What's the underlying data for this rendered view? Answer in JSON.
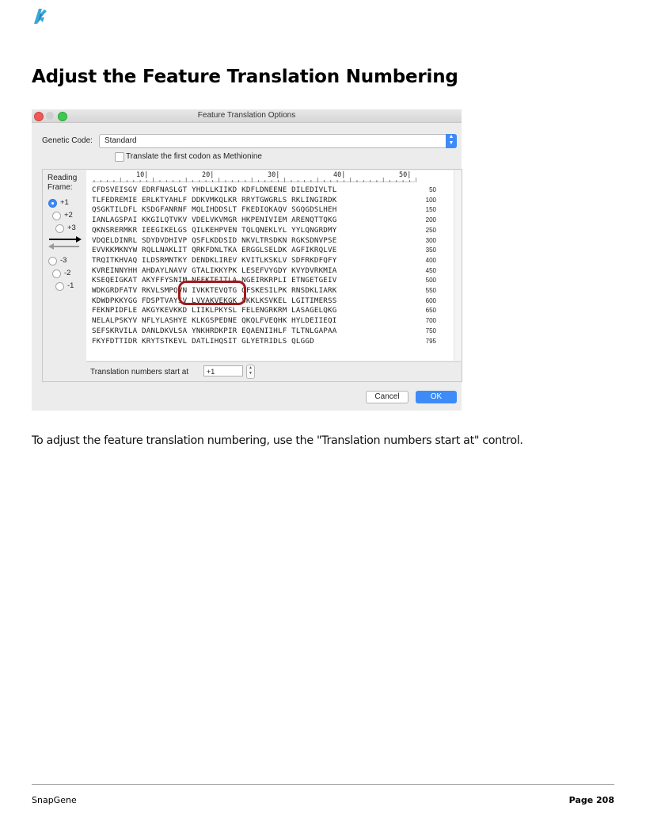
{
  "page": {
    "title": "Adjust the Feature Translation Numbering",
    "body": "To adjust the feature translation numbering, use the \"Translation numbers start at\" control.",
    "footer_left": "SnapGene",
    "footer_right": "Page 208"
  },
  "dialog": {
    "title": "Feature Translation Options",
    "genetic_code_label": "Genetic Code:",
    "genetic_code_value": "Standard",
    "methionine_label": "Translate the first codon as Methionine",
    "methionine_checked": false,
    "reading_frame_label_1": "Reading",
    "reading_frame_label_2": "Frame:",
    "frames": [
      "+1",
      "+2",
      "+3",
      "-3",
      "-2",
      "-1"
    ],
    "selected_frame": "+1",
    "ruler": [
      "10|",
      "20|",
      "30|",
      "40|",
      "50|"
    ],
    "sequence_rows": [
      {
        "seq": "CFDSVEISGV EDRFNASLGT YHDLLKIIKD KDFLDNEENE DILEDIVLTL",
        "num": "50"
      },
      {
        "seq": "TLFEDREMIE ERLKTYAHLF DDKVMKQLKR RRYTGWGRLS RKLINGIRDK",
        "num": "100"
      },
      {
        "seq": "QSGKTILDFL KSDGFANRNF MQLIHDDSLT FKEDIQKAQV SGQGDSLHEH",
        "num": "150"
      },
      {
        "seq": "IANLAGSPAI KKGILQTVKV VDELVKVMGR HKPENIVIEM ARENQTTQKG",
        "num": "200"
      },
      {
        "seq": "QKNSRERMKR IEEGIKELGS QILKEHPVEN TQLQNEKLYL YYLQNGRDMY",
        "num": "250"
      },
      {
        "seq": "VDQELDINRL SDYDVDHIVP QSFLKDDSID NKVLTRSDKN RGKSDNVPSE",
        "num": "300"
      },
      {
        "seq": "EVVKKMKNYW RQLLNAKLIT QRKFDNLTKA ERGGLSELDK AGFIKRQLVE",
        "num": "350"
      },
      {
        "seq": "TRQITKHVAQ ILDSRMNTKY DENDKLIREV KVITLKSKLV SDFRKDFQFY",
        "num": "400"
      },
      {
        "seq": "KVREINNYHH AHDAYLNAVV GTALIKKYPK LESEFVYGDY KVYDVRKMIA",
        "num": "450"
      },
      {
        "seq": "KSEQEIGKAT AKYFFYSNIM NFFKTEITLA NGEIRKRPLI ETNGETGEIV",
        "num": "500"
      },
      {
        "seq": "WDKGRDFATV RKVLSMPQVN IVKKTEVQTG GFSKESILPK RNSDKLIARK",
        "num": "550"
      },
      {
        "seq": "KDWDPKKYGG FDSPTVAYSV LVVAKVEKGK SKKLKSVKEL LGITIMERSS",
        "num": "600"
      },
      {
        "seq": "FEKNPIDFLE AKGYKEVKKD LIIKLPKYSL FELENGRKRM LASAGELQKG",
        "num": "650"
      },
      {
        "seq": "NELALPSKYV NFLYLASHYE KLKGSPEDNE QKQLFVEQHK HYLDEIIEQI",
        "num": "700"
      },
      {
        "seq": "SEFSKRVILA DANLDKVLSA YNKHRDKPIR EQAENIIHLF TLTNLGAPAA",
        "num": "750"
      },
      {
        "seq": "FKYFDTTIDR KRYTSTKEVL DATLIHQSIT GLYETRIDLS QLGGD",
        "num": "795"
      }
    ],
    "start_at_label": "Translation numbers start at",
    "start_at_value": "+1",
    "cancel_label": "Cancel",
    "ok_label": "OK",
    "colors": {
      "accent": "#3e8bf7",
      "highlight": "#a01b1b"
    }
  }
}
